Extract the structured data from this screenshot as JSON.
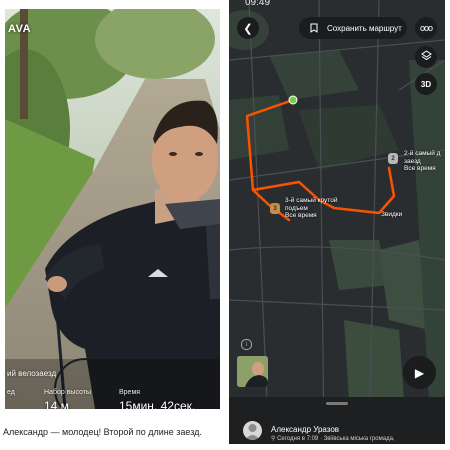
{
  "photo": {
    "brand": "AVA",
    "activity_type": "ий велозаезд",
    "stats": {
      "distance_label": "ед",
      "distance_value": "",
      "elevation_label": "Набор высоты",
      "elevation_value": "14 м",
      "time_label": "Время",
      "time_value": "15мин. 42сек."
    }
  },
  "caption": "Александр — молодец! Второй по длине заезд.",
  "map": {
    "status_time": "09:49",
    "save_route_label": "Сохранить маршрут",
    "btn_3d_label": "3D",
    "segments": [
      {
        "label_line1": "3-й самый крутой",
        "label_line2": "подъем",
        "label_line3": "Все время",
        "medal": "3"
      },
      {
        "label_line1": "2-й самый д",
        "label_line2": "заезд",
        "label_line3": "Все время",
        "medal": "2"
      },
      {
        "label_line1": "Звидки",
        "label_line2": "",
        "label_line3": "",
        "medal": ""
      }
    ],
    "icons": {
      "back": "chevron-left-icon",
      "bookmark": "bookmark-icon",
      "more": "more-dots-icon",
      "layers": "layers-icon",
      "info": "info-icon",
      "play": "play-icon"
    },
    "colors": {
      "route": "#fc5200",
      "start_marker": "#6fd14a",
      "map_bg": "#2a2d30",
      "water": "#3a443d"
    }
  },
  "sheet": {
    "user_name": "Александр Уразов",
    "meta": "Сегодня в 7:09 · Звіївська міська громада,"
  }
}
